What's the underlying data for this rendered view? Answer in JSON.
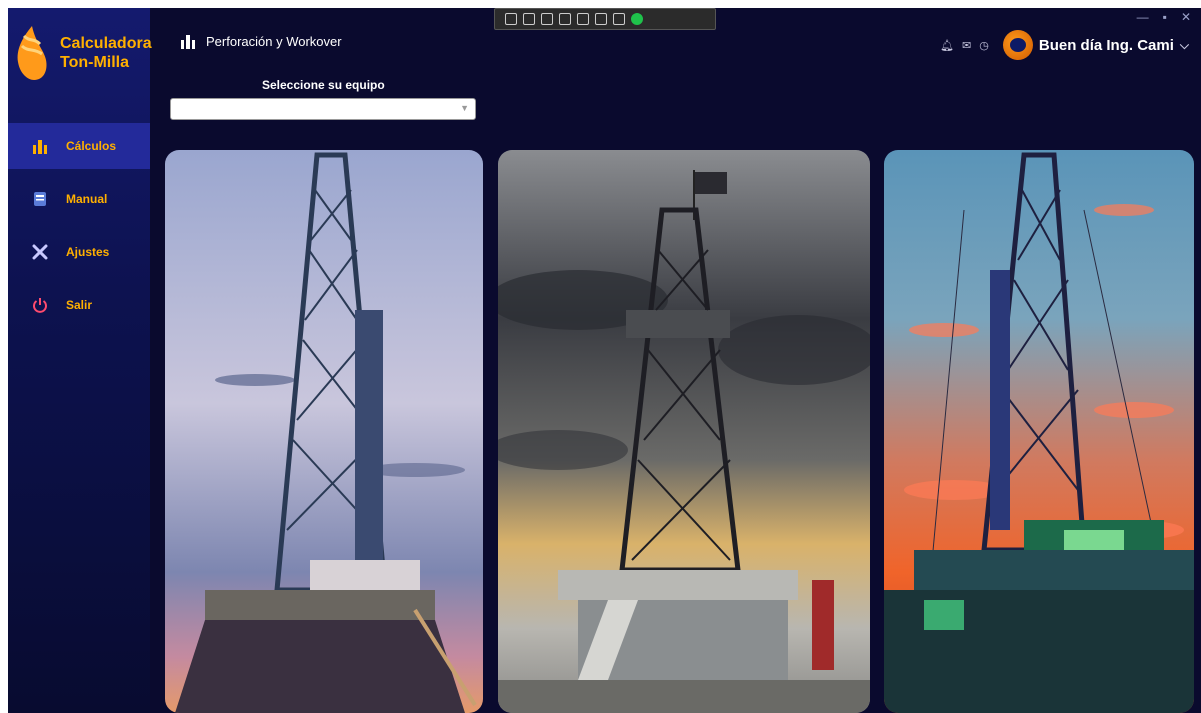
{
  "app": {
    "title_line1": "Calculadora",
    "title_line2": "Ton-Milla"
  },
  "sidebar": {
    "items": [
      {
        "label": "Cálculos",
        "icon": "drill-rig-icon",
        "active": true
      },
      {
        "label": "Manual",
        "icon": "book-icon",
        "active": false
      },
      {
        "label": "Ajustes",
        "icon": "tools-icon",
        "active": false
      },
      {
        "label": "Salir",
        "icon": "power-icon",
        "active": false
      }
    ]
  },
  "header": {
    "section_title": "Perforación y Workover",
    "greeting": "Buen día Ing. Cami"
  },
  "equipment": {
    "label": "Seleccione su equipo",
    "value": ""
  },
  "colors": {
    "accent": "#ffb000",
    "sidebar": "#141a6e",
    "background": "#0a0a2e",
    "active_item": "#232a9a"
  },
  "images": [
    {
      "name": "drilling-rig-photo-dusk"
    },
    {
      "name": "drilling-rig-photo-flag"
    },
    {
      "name": "drilling-rig-photo-sunset"
    }
  ]
}
